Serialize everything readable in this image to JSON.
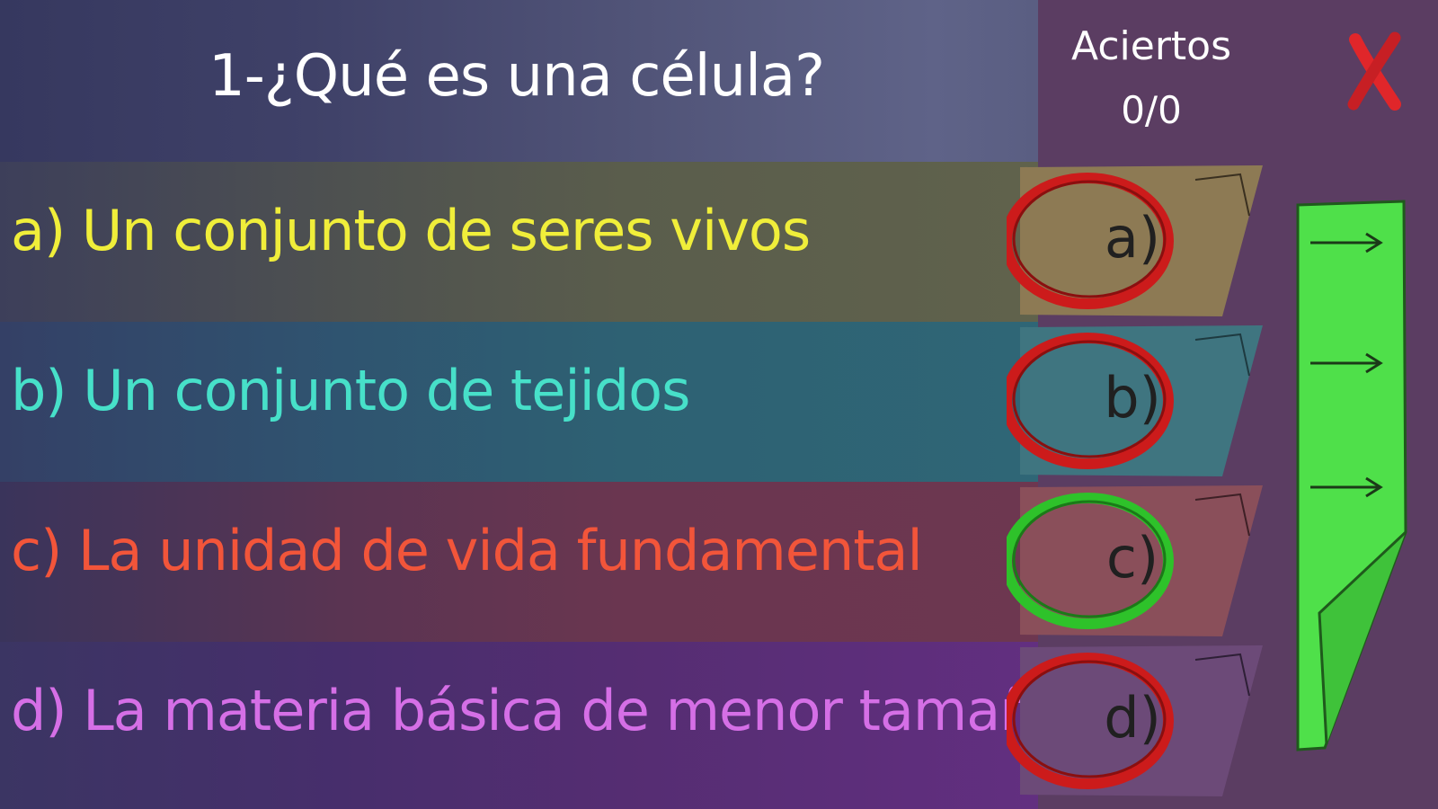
{
  "quiz": {
    "question": "1-¿Qué es una célula?",
    "options": [
      {
        "text": "a) Un conjunto de seres vivos",
        "color": "#f0ee3a",
        "band": "#5a5d4c"
      },
      {
        "text": "b) Un conjunto de tejidos",
        "color": "#47e0c9",
        "band": "#2e6173"
      },
      {
        "text": "c) La unidad de vida fundamental",
        "color": "#f2553a",
        "band": "#6a3650"
      },
      {
        "text": "d) La materia básica de menor tamaño",
        "color": "#d56fe6",
        "band": "#552d72"
      }
    ]
  },
  "score": {
    "title": "Aciertos",
    "value": "0/0"
  },
  "answer_tabs": [
    {
      "letter": "a)",
      "ring_color": "#cc1b1b",
      "tab_color": "#8d7a54"
    },
    {
      "letter": "b)",
      "ring_color": "#cc1b1b",
      "tab_color": "#3f7580"
    },
    {
      "letter": "c)",
      "ring_color": "#2ec22a",
      "tab_color": "#8a4f5a"
    },
    {
      "letter": "d)",
      "ring_color": "#cc1b1b",
      "tab_color": "#6c4a78"
    }
  ],
  "icons": {
    "close": "close-x-icon",
    "next": "arrow-right-icon"
  },
  "colors": {
    "next_panel": "#4fe04a",
    "close": "#e0262a"
  }
}
